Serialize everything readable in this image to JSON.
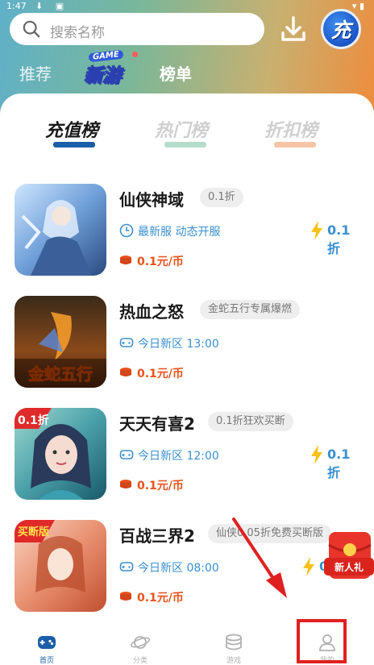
{
  "status_bar": {
    "time": "1:47",
    "icons": "⬇ ▣",
    "right": "▾ ▮"
  },
  "search": {
    "placeholder": "搜索名称"
  },
  "header": {
    "recharge_label": "充"
  },
  "top_tabs": {
    "recommend": "推荐",
    "newgame_badge": "GAME",
    "newgame": "新游",
    "rank": "榜单"
  },
  "rank_tabs": [
    "充值榜",
    "热门榜",
    "折扣榜"
  ],
  "games": [
    {
      "name": "仙侠神域",
      "tag": "0.1折",
      "info": "最新服 动态开服",
      "info_icon": "clock-icon",
      "price": "0.1元/币",
      "discount": "0.1折"
    },
    {
      "name": "热血之怒",
      "tag": "金蛇五行专属爆燃",
      "info": "今日新区 13:00",
      "info_icon": "gamepad-icon",
      "price": "0.1元/币",
      "discount": ""
    },
    {
      "name": "天天有喜2",
      "tag": "0.1折狂欢买断",
      "info": "今日新区 12:00",
      "info_icon": "gamepad-icon",
      "price": "0.1元/币",
      "discount": "0.1折"
    },
    {
      "name": "百战三界2",
      "tag": "仙侠0.05折免费买断版",
      "info": "今日新区 08:00",
      "info_icon": "gamepad-icon",
      "price": "0.1元/币",
      "discount": "0."
    }
  ],
  "icon_text": {
    "game2": "金蛇五行",
    "game3_badge": "0.1折",
    "game4_badge": "买断版"
  },
  "gift_badge": "新人礼",
  "bottom_nav": [
    {
      "label": "首页",
      "icon": "gamepad-icon",
      "active": true
    },
    {
      "label": "分类",
      "icon": "planet-icon",
      "active": false
    },
    {
      "label": "游戏",
      "icon": "coins-icon",
      "active": false
    },
    {
      "label": "我的",
      "icon": "user-icon",
      "active": false
    }
  ],
  "colors": {
    "accent": "#1b5ea8",
    "price": "#e8521c",
    "info": "#3a8fd0",
    "highlight": "#e02020"
  }
}
